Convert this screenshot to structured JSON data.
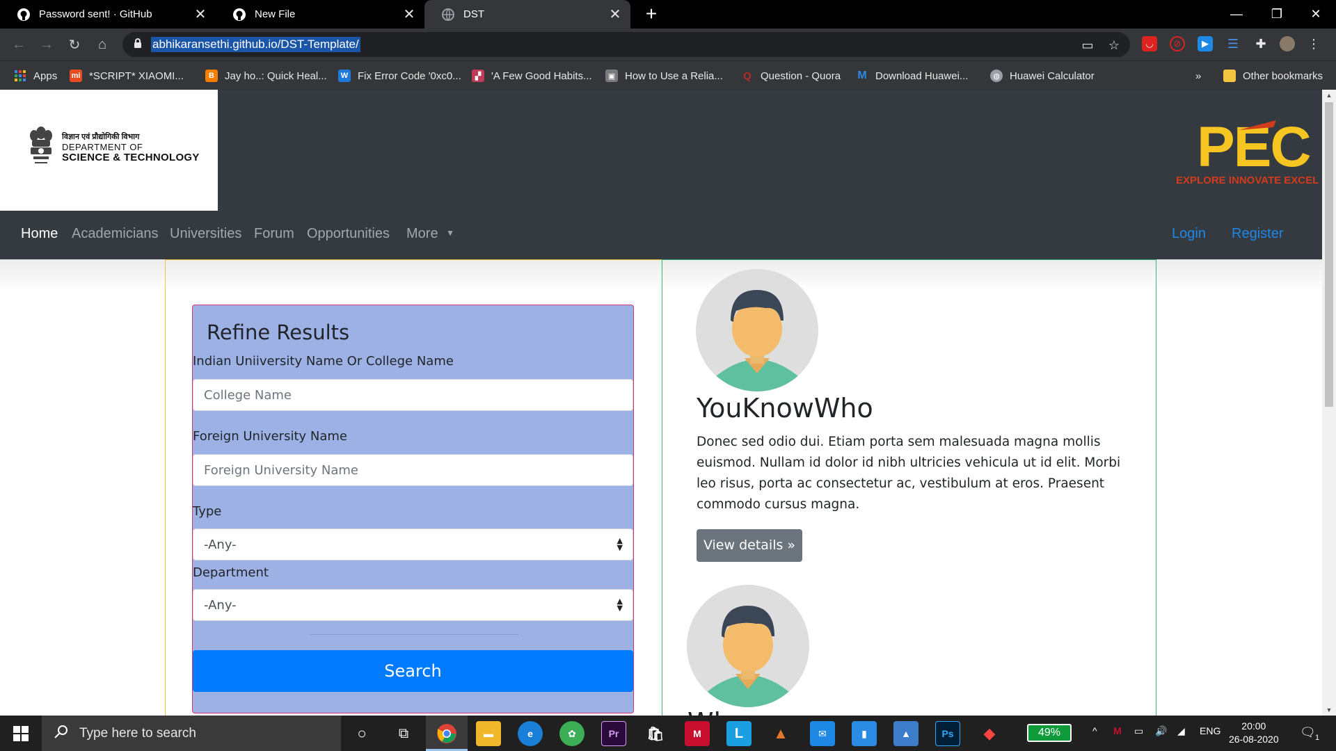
{
  "browser": {
    "tabs": [
      {
        "title": "Password sent! · GitHub",
        "icon": "github-icon",
        "active": false
      },
      {
        "title": "New File",
        "icon": "github-icon",
        "active": false
      },
      {
        "title": "DST",
        "icon": "globe-icon",
        "active": true
      }
    ],
    "url": "abhikaransethi.github.io/DST-Template/",
    "bookmarks": [
      {
        "label": "Apps",
        "icon": "apps-grid-icon",
        "color": "#4285f4"
      },
      {
        "label": "*SCRIPT* XIAOMI...",
        "icon": "xiaomi-icon",
        "color": "#e84c22"
      },
      {
        "label": "Jay ho..: Quick Heal...",
        "icon": "blogger-icon",
        "color": "#f57d00"
      },
      {
        "label": "Fix Error Code '0xc0...",
        "icon": "w-icon",
        "color": "#1e7ad6"
      },
      {
        "label": "'A Few Good Habits...",
        "icon": "image-icon",
        "color": "#c23c5a"
      },
      {
        "label": "How to Use a Relia...",
        "icon": "briefcase-icon",
        "color": "#7a7a7a"
      },
      {
        "label": "Question - Quora",
        "icon": "quora-icon",
        "color": "#b92b27"
      },
      {
        "label": "Download Huawei...",
        "icon": "m-icon",
        "color": "#2b8ae2"
      },
      {
        "label": "Huawei Calculator",
        "icon": "globe-icon",
        "color": "#9aa0a6"
      }
    ],
    "other_bookmarks": "Other bookmarks",
    "overflow": "»"
  },
  "header": {
    "dst_hindi": "विज्ञान एवं प्रौद्योगिकी विभाग",
    "dst_dept": "DEPARTMENT OF",
    "dst_sci": "SCIENCE & TECHNOLOGY",
    "pec_letters": "PEC",
    "pec_tagline": "EXPLORE INNOVATE EXCEL"
  },
  "nav": {
    "items": [
      "Home",
      "Academicians",
      "Universities",
      "Forum",
      "Opportunities",
      "More"
    ],
    "login": "Login",
    "register": "Register"
  },
  "refine": {
    "title": "Refine Results",
    "indian_label": "Indian Uniiversity Name Or College Name",
    "indian_placeholder": "College Name",
    "foreign_label": "Foreign University Name",
    "foreign_placeholder": "Foreign University Name",
    "type_label": "Type",
    "type_value": "-Any-",
    "dept_label": "Department",
    "dept_value": "-Any-",
    "search": "Search"
  },
  "person": {
    "name": "YouKnowWho",
    "bio": "Donec sed odio dui. Etiam porta sem malesuada magna mollis euismod. Nullam id dolor id nibh ultricies vehicula ut id elit. Morbi leo risus, porta ac consectetur ac, vestibulum at eros. Praesent commodo cursus magna.",
    "details": "View details »",
    "second_name_partial": "Wh"
  },
  "taskbar": {
    "search_text": "Type here to search",
    "battery": "49%",
    "lang": "ENG",
    "time": "20:00",
    "date": "26-08-2020",
    "notif_count": "1"
  }
}
